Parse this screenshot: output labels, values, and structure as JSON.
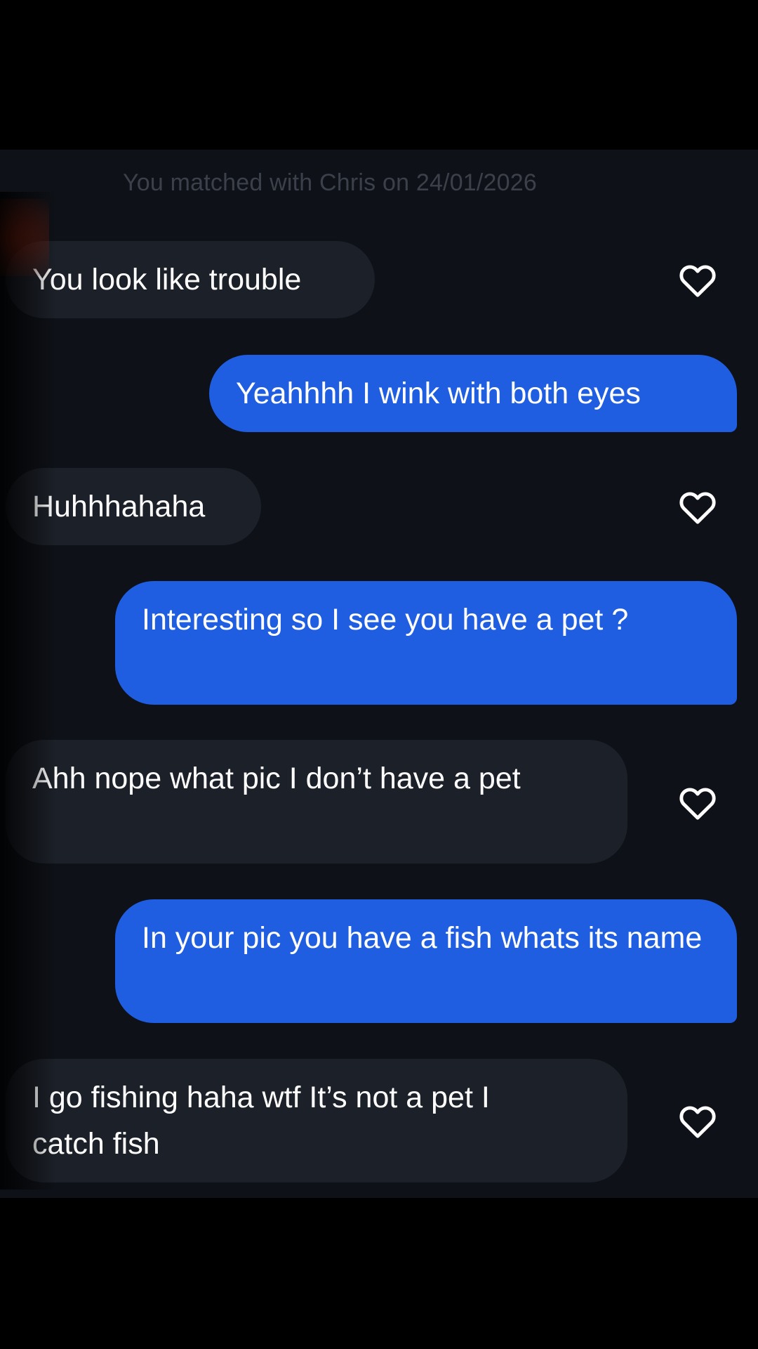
{
  "match_note": "You matched with Chris on 24/01/2026",
  "messages": [
    {
      "direction": "incoming",
      "text": "You look like trouble",
      "liked": false
    },
    {
      "direction": "outgoing",
      "text": "Yeahhhh I wink with both eyes"
    },
    {
      "direction": "incoming",
      "text": "Huhhhahaha",
      "liked": false
    },
    {
      "direction": "outgoing",
      "text": "Interesting so I see you have a pet ?"
    },
    {
      "direction": "incoming",
      "text": "Ahh nope what pic I don’t have a pet",
      "liked": false
    },
    {
      "direction": "outgoing",
      "text": "In your pic you have a fish whats its name"
    },
    {
      "direction": "incoming",
      "text": "I go fishing haha wtf It’s not a pet I catch fish",
      "liked": false
    }
  ],
  "icons": {
    "like": "heart-outline-icon"
  },
  "colors": {
    "page_background": "#000000",
    "chat_background": "#0e1117",
    "incoming_bubble": "#1c2028",
    "outgoing_bubble": "#1f5ee0",
    "match_note_text": "#3b404a",
    "message_text": "#ffffff"
  }
}
